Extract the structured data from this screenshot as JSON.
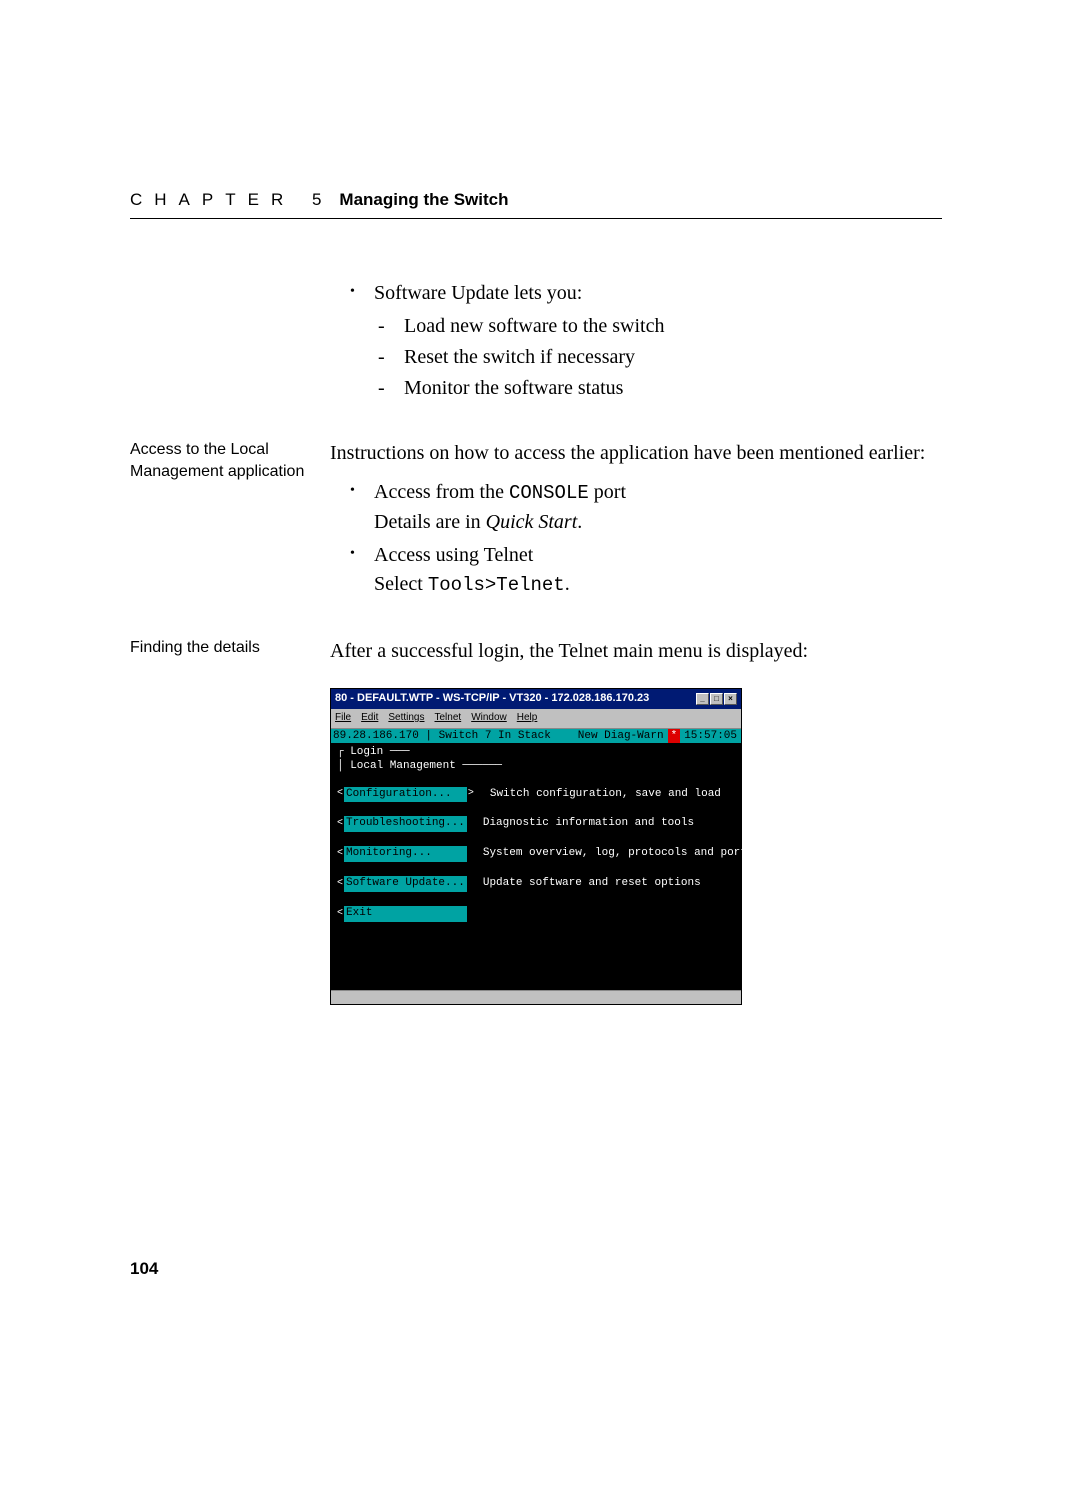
{
  "chapter": {
    "label": "CHAPTER 5",
    "title": "Managing the Switch"
  },
  "section1": {
    "lead": "Software Update lets you:",
    "subs": [
      "Load new software to the switch",
      "Reset the switch if necessary",
      "Monitor the software status"
    ]
  },
  "section2": {
    "sidebar": "Access to the Local Management application",
    "intro": "Instructions on how to access the application have been mentioned earlier:",
    "b1_pre": "Access from the ",
    "b1_code": "CONSOLE",
    "b1_post": " port",
    "b1_detail_pre": "Details are in ",
    "b1_detail_ital": "Quick Start",
    "b1_detail_post": ".",
    "b2": "Access using Telnet",
    "b2_detail_pre": "Select ",
    "b2_detail_code": "Tools>Telnet",
    "b2_detail_post": "."
  },
  "section3": {
    "sidebar": "Finding the details",
    "intro": "After a successful login, the Telnet main menu is displayed:"
  },
  "screenshot": {
    "title": "80 - DEFAULT.WTP - WS-TCP/IP - VT320 - 172.028.186.170.23",
    "menus": {
      "file": "File",
      "edit": "Edit",
      "settings": "Settings",
      "telnet": "Telnet",
      "window": "Window",
      "help": "Help"
    },
    "status": {
      "ip": "89.28.186.170",
      "swnum": "Switch 7 In Stack",
      "warn": "New Diag-Warn",
      "dot": "*",
      "time": "15:57:05"
    },
    "login": "Login",
    "header": "Local Management",
    "rows": [
      {
        "btn": "Configuration...  ",
        "desc": "Switch configuration, save and load",
        "caret": true
      },
      {
        "btn": "Troubleshooting...",
        "desc": "Diagnostic information and tools",
        "caret": false
      },
      {
        "btn": "Monitoring...     ",
        "desc": "System overview, log, protocols and port status",
        "caret": false
      },
      {
        "btn": "Software Update...",
        "desc": "Update software and reset options",
        "caret": false
      },
      {
        "btn": "Exit              ",
        "desc": "",
        "caret": false
      }
    ]
  },
  "page_number": "104"
}
